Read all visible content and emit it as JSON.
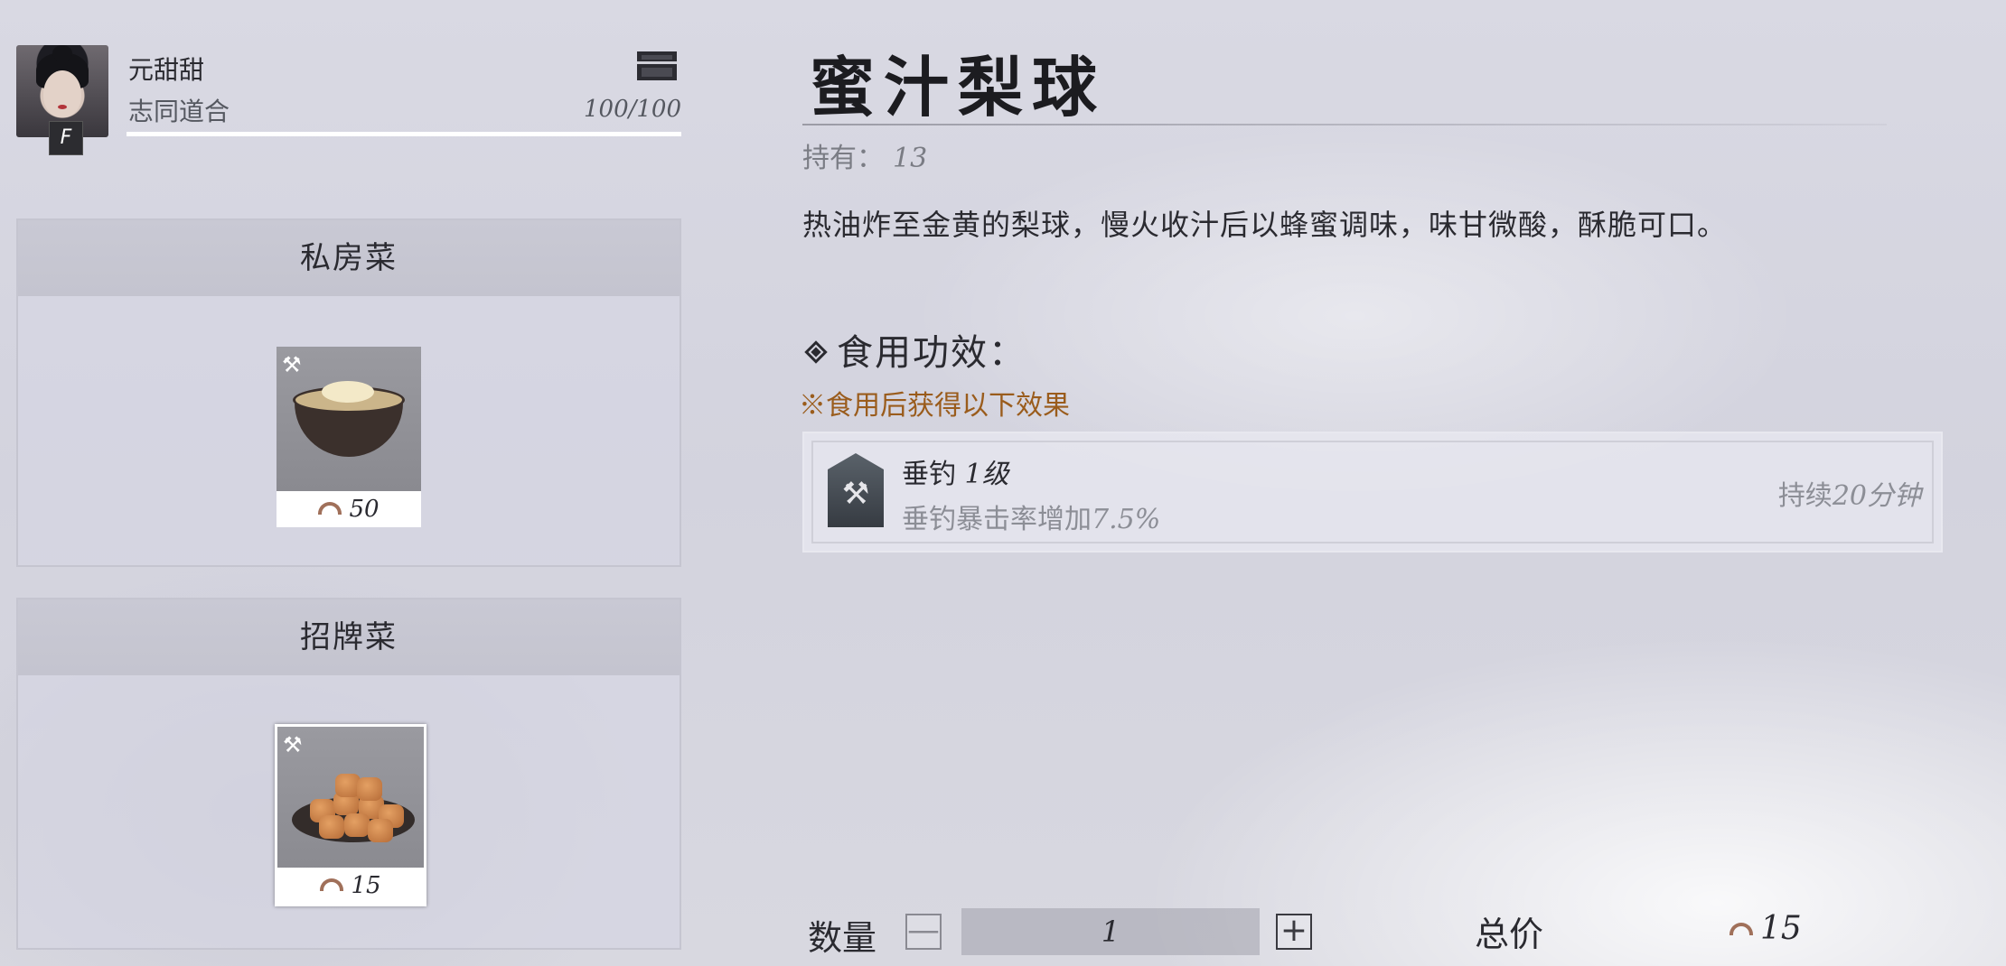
{
  "profile": {
    "name": "元甜甜",
    "relation": "志同道合",
    "rank": "F",
    "favor_text": "100/100",
    "favor_fraction": 1.0
  },
  "panels": [
    {
      "title": "私房菜",
      "dish": {
        "price": "50",
        "icon": "bowl-dish"
      }
    },
    {
      "title": "招牌菜",
      "dish": {
        "price": "15",
        "icon": "pear-balls-dish",
        "selected": true
      }
    }
  ],
  "detail": {
    "title": "蜜汁梨球",
    "owned_label": "持有：",
    "owned_value": "13",
    "description": "热油炸至金黄的梨球，慢火收汁后以蜂蜜调味，味甘微酸，酥脆可口。",
    "effect_heading": "食用功效：",
    "effect_note": "※食用后获得以下效果",
    "buff": {
      "name": "垂钓",
      "level": "1级",
      "desc_prefix": "垂钓暴击率增加",
      "desc_value": "7.5%",
      "duration_prefix": "持续",
      "duration_value": "20分钟",
      "icon": "fishing-tool-icon"
    }
  },
  "purchase": {
    "qty_label": "数量",
    "minus": "—",
    "plus": "+",
    "quantity": "1",
    "total_label": "总价",
    "total_value": "15"
  },
  "colors": {
    "note": "#9a5c1c",
    "muted": "#8c8e96"
  }
}
